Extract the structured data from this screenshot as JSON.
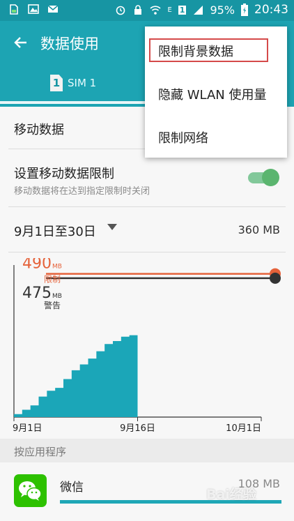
{
  "status_bar": {
    "icons_left": [
      "sd-card-icon",
      "gallery-icon",
      "mail-icon"
    ],
    "icons_right": [
      "alarm-icon",
      "lock-icon",
      "wifi-icon",
      "sim-icon",
      "signal-icon"
    ],
    "network_type": "E",
    "sim_number": "1",
    "battery": "95%",
    "time": "20:43",
    "background": "#1795a3"
  },
  "appbar": {
    "title": "数据使用",
    "background": "#1da4b3"
  },
  "tabs": [
    {
      "badge": "1",
      "label": "SIM 1"
    }
  ],
  "settings": {
    "mobile_data": "移动数据",
    "limit_title": "设置移动数据限制",
    "limit_subtitle": "移动数据将在达到指定限制时关闭",
    "limit_enabled": true,
    "period_label": "9月1日至30日",
    "period_usage": "360 MB"
  },
  "chart_data": {
    "type": "area",
    "limit": {
      "value": "490",
      "unit": "MB",
      "label": "限制",
      "color": "#e5623a"
    },
    "warning": {
      "value": "475",
      "unit": "MB",
      "label": "警告",
      "color": "#333333"
    },
    "x_tick_labels": [
      "9月1日",
      "9月16日",
      "10月1日"
    ],
    "x_days": [
      1,
      2,
      3,
      4,
      5,
      6,
      7,
      8,
      9,
      10,
      11,
      12,
      13,
      14,
      15
    ],
    "y_cumulative_mb": [
      10,
      25,
      40,
      70,
      90,
      100,
      130,
      160,
      180,
      200,
      225,
      250,
      260,
      275,
      280
    ],
    "ylim": [
      0,
      520
    ],
    "fill_color": "#1ba6b8"
  },
  "apps_section": {
    "header": "按应用程序",
    "apps": [
      {
        "name": "微信",
        "size": "108 MB",
        "usage_fraction": 1.0,
        "icon": "wechat-icon"
      }
    ]
  },
  "overflow_menu": {
    "items": [
      "限制背景数据",
      "隐藏 WLAN 使用量",
      "限制网络"
    ],
    "highlighted_index": 0,
    "highlight_color": "#d54a4a"
  },
  "watermark": "Bai经验"
}
